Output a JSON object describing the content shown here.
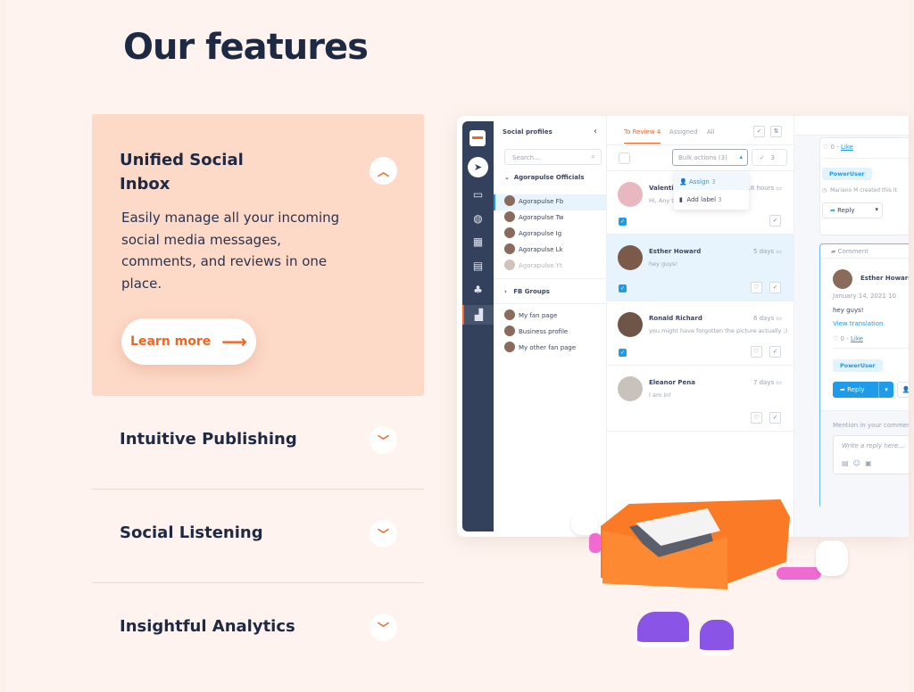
{
  "heading": "Our features",
  "features": [
    {
      "title": "Unified Social Inbox",
      "description": "Easily manage all your incoming social media messages, comments, and reviews in one place.",
      "cta": "Learn more",
      "expanded": true
    },
    {
      "title": "Intuitive Publishing",
      "expanded": false
    },
    {
      "title": "Social Listening",
      "expanded": false
    },
    {
      "title": "Insightful Analytics",
      "expanded": false
    }
  ],
  "colors": {
    "accent": "#f26522",
    "navy": "#1e2a44",
    "card": "#fdd9c7",
    "app_blue": "#1e9be9"
  },
  "app": {
    "profiles_title": "Social profiles",
    "search_placeholder": "Search...",
    "group1": "Agorapulse Officials",
    "profiles": [
      "Agorapulse Fb",
      "Agorapulse Tw",
      "Agorapulse Ig",
      "Agorapulse Lk",
      "Agorapulse Yt"
    ],
    "group2": "FB Groups",
    "pages": [
      "My fan page",
      "Business profile",
      "My other fan page"
    ],
    "tabs": [
      {
        "label": "To Review",
        "count": "4"
      },
      {
        "label": "Assigned"
      },
      {
        "label": "All"
      }
    ],
    "bulk_actions": "Bulk actions (3)",
    "check_count": "3",
    "menu": [
      {
        "label": "Assign",
        "count": "3"
      },
      {
        "label": "Add label",
        "count": "3"
      }
    ],
    "messages": [
      {
        "name": "Valentina",
        "time": "18 hours",
        "text": "Hi, Any t... ue Monday?",
        "checked": true
      },
      {
        "name": "Esther Howard",
        "time": "5 days",
        "text": "hey guys!",
        "checked": true,
        "selected": true
      },
      {
        "name": "Ronald Richard",
        "time": "6 days",
        "text": "you might have forgotten the picture actually ;)",
        "checked": true
      },
      {
        "name": "Eleanor Pena",
        "time": "7 days",
        "text": "I am in!",
        "checked": false
      }
    ],
    "detail": {
      "like_count": "0 -",
      "like": "Like",
      "tag": "PowerUser",
      "created": "Mariano M created this it",
      "reply": "Reply",
      "comment_label": "Comment",
      "author": "Esther Howard",
      "date": "January 14, 2021 10",
      "text": "hey guys!",
      "view_translation": "View translation",
      "mention": "Mention in your comment",
      "reply_placeholder": "Write a reply here..."
    }
  }
}
